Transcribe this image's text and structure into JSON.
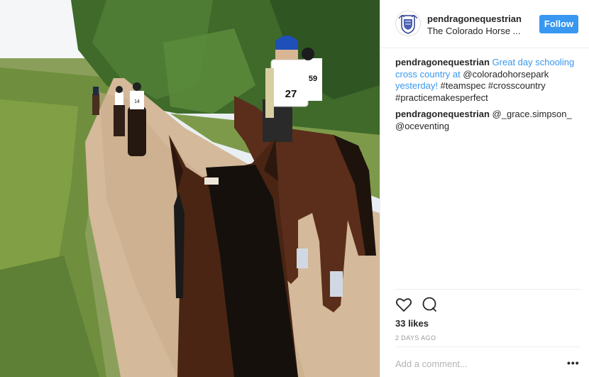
{
  "header": {
    "username": "pendragonequestrian",
    "subtitle": "The Colorado Horse ...",
    "follow_label": "Follow"
  },
  "photo": {
    "bib_front": "27",
    "bib_back": "59",
    "bib_far": "14"
  },
  "comments": [
    {
      "user": "pendragonequestrian",
      "link_text": "Great day schooling cross country at",
      "mention": "@coloradohorsepark",
      "link_text2": "yesterday!",
      "tags": "#teamspec #crosscountry #practicemakesperfect"
    },
    {
      "user": "pendragonequestrian",
      "text": "@_grace.simpson_ @oceventing"
    }
  ],
  "actions": {
    "like_icon": "heart-icon",
    "comment_icon": "comment-bubble-icon"
  },
  "likes": "33 likes",
  "time": "2 DAYS AGO",
  "comment_box": {
    "placeholder": "Add a comment...",
    "more": "•••"
  },
  "colors": {
    "follow_blue": "#3897f0",
    "link_blue": "#3897f0",
    "border": "#efefef"
  }
}
